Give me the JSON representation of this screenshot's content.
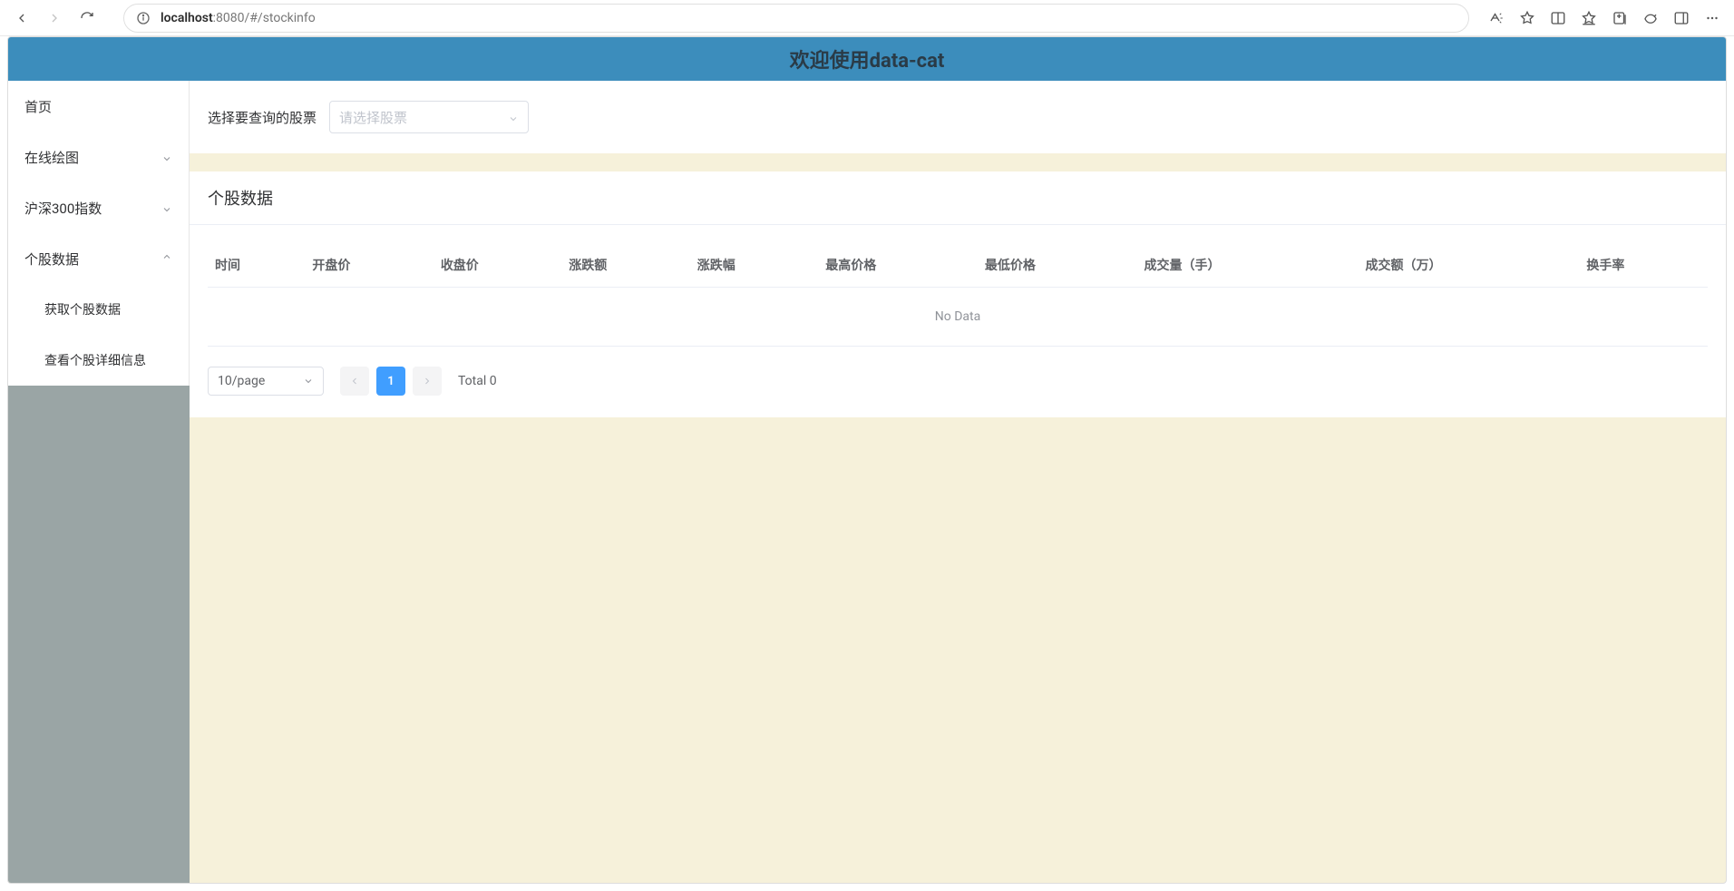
{
  "browser": {
    "url_host": "localhost",
    "url_port_path": ":8080/#/stockinfo"
  },
  "header": {
    "title": "欢迎使用data-cat"
  },
  "sidebar": {
    "items": [
      {
        "label": "首页",
        "has_children": false,
        "expanded": false
      },
      {
        "label": "在线绘图",
        "has_children": true,
        "expanded": false
      },
      {
        "label": "沪深300指数",
        "has_children": true,
        "expanded": false
      },
      {
        "label": "个股数据",
        "has_children": true,
        "expanded": true,
        "children": [
          {
            "label": "获取个股数据"
          },
          {
            "label": "查看个股详细信息"
          }
        ]
      }
    ]
  },
  "filter": {
    "label": "选择要查询的股票",
    "placeholder": "请选择股票"
  },
  "panel": {
    "title": "个股数据",
    "columns": [
      "时间",
      "开盘价",
      "收盘价",
      "涨跌额",
      "涨跌幅",
      "最高价格",
      "最低价格",
      "成交量（手）",
      "成交额（万）",
      "换手率"
    ],
    "no_data": "No Data"
  },
  "pagination": {
    "page_size_label": "10/page",
    "current_page": "1",
    "total_label": "Total 0"
  }
}
